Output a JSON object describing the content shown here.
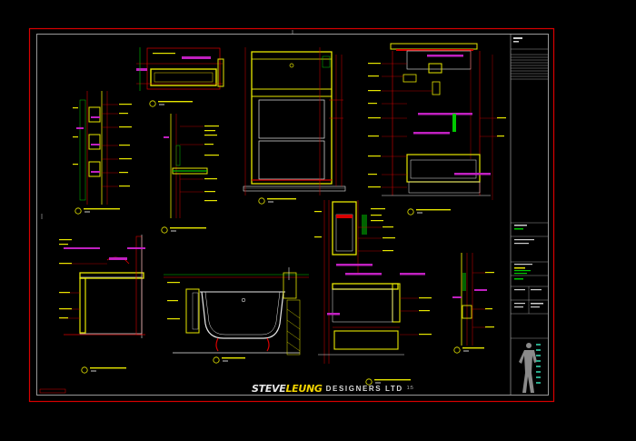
{
  "drawing": {
    "brand_prefix": "STEVE",
    "brand_suffix": "LEUNG",
    "firm": "DESIGNERS LTD",
    "scale": "1:5",
    "colors": {
      "background": "#000000",
      "border": "#d80000",
      "frame": "#c8c8c8",
      "yellow": "#e6e600",
      "red": "#e00000",
      "magenta": "#d020d0",
      "white": "#e8e8e8",
      "green": "#00c800",
      "cyan": "#00d0d0"
    }
  }
}
